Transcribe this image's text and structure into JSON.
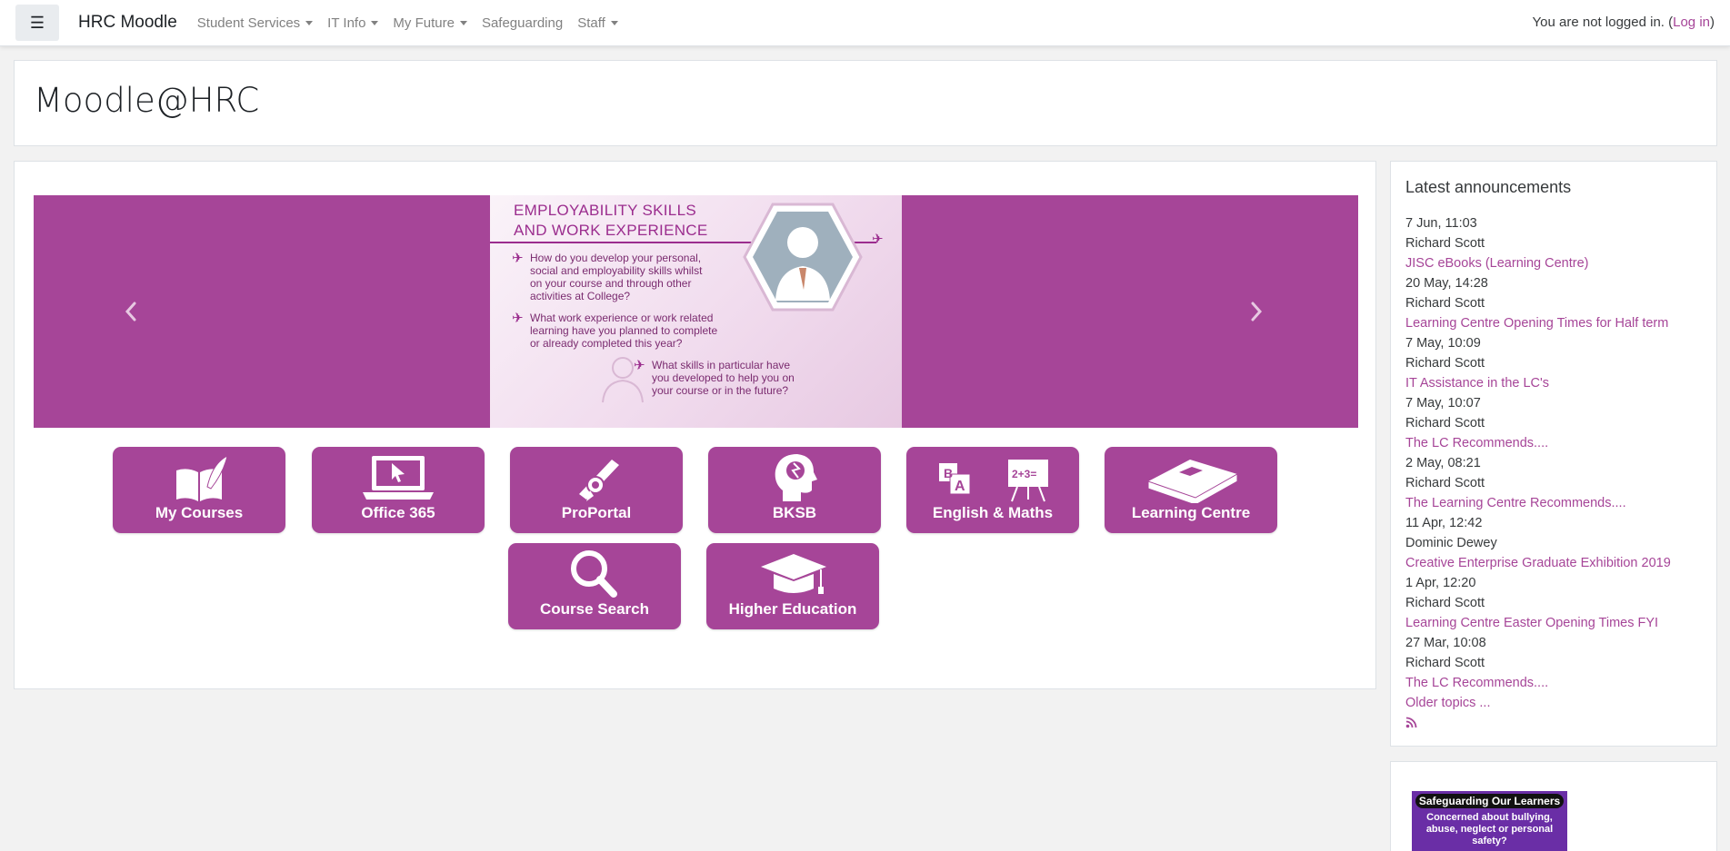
{
  "navbar": {
    "toggle_icon": "hamburger-icon",
    "brand": "HRC Moodle",
    "links": [
      {
        "label": "Student Services",
        "dropdown": true
      },
      {
        "label": "IT Info",
        "dropdown": true
      },
      {
        "label": "My Future",
        "dropdown": true
      },
      {
        "label": "Safeguarding",
        "dropdown": false
      },
      {
        "label": "Staff",
        "dropdown": true
      }
    ],
    "login_status": "You are not logged in.",
    "login_link": "Log in"
  },
  "header": {
    "title": "Moodle@HRC"
  },
  "carousel": {
    "prev_icon": "chevron-left-icon",
    "next_icon": "chevron-right-icon",
    "slide": {
      "title_line1": "EMPLOYABILITY SKILLS",
      "title_line2": "AND WORK EXPERIENCE",
      "q1_l1": "How do you develop your personal,",
      "q1_l2": "social and employability skills whilst",
      "q1_l3": "on your course and through other",
      "q1_l4": "activities at College?",
      "q2_l1": "What work experience or work related",
      "q2_l2": "learning have you planned to complete",
      "q2_l3": "or already completed this year?",
      "q3_l1": "What skills in particular have",
      "q3_l2": "you developed to help you on",
      "q3_l3": "your course or in the future?"
    }
  },
  "tiles": [
    {
      "label": "My Courses",
      "icon": "book-quill-icon"
    },
    {
      "label": "Office 365",
      "icon": "laptop-cursor-icon"
    },
    {
      "label": "ProPortal",
      "icon": "diploma-icon"
    },
    {
      "label": "BKSB",
      "icon": "head-brain-icon"
    },
    {
      "label": "English & Maths",
      "icon": "blocks-whiteboard-icon"
    },
    {
      "label": "Learning Centre",
      "icon": "closed-book-icon"
    },
    {
      "label": "Course Search",
      "icon": "magnifier-icon"
    },
    {
      "label": "Higher Education",
      "icon": "graduation-cap-icon"
    }
  ],
  "announcements": {
    "title": "Latest announcements",
    "items": [
      {
        "date": "7 Jun, 11:03",
        "author": "Richard Scott",
        "title": "JISC eBooks (Learning Centre)"
      },
      {
        "date": "20 May, 14:28",
        "author": "Richard Scott",
        "title": "Learning Centre Opening Times for Half term"
      },
      {
        "date": "7 May, 10:09",
        "author": "Richard Scott",
        "title": "IT Assistance in the LC's"
      },
      {
        "date": "7 May, 10:07",
        "author": "Richard Scott",
        "title": "The LC Recommends...."
      },
      {
        "date": "2 May, 08:21",
        "author": "Richard Scott",
        "title": "The Learning Centre Recommends...."
      },
      {
        "date": "11 Apr, 12:42",
        "author": "Dominic Dewey",
        "title": "Creative Enterprise Graduate Exhibition 2019"
      },
      {
        "date": "1 Apr, 12:20",
        "author": "Richard Scott",
        "title": "Learning Centre Easter Opening Times FYI"
      },
      {
        "date": "27 Mar, 10:08",
        "author": "Richard Scott",
        "title": "The LC Recommends...."
      }
    ],
    "older": "Older topics ...",
    "rss_icon": "rss-icon"
  },
  "safeguarding": {
    "heading": "Safeguarding Our Learners",
    "text": "Concerned about bullying, abuse, neglect or personal safety?"
  },
  "colors": {
    "brand": "#a64598",
    "text": "#373a3c",
    "muted": "#818181"
  }
}
